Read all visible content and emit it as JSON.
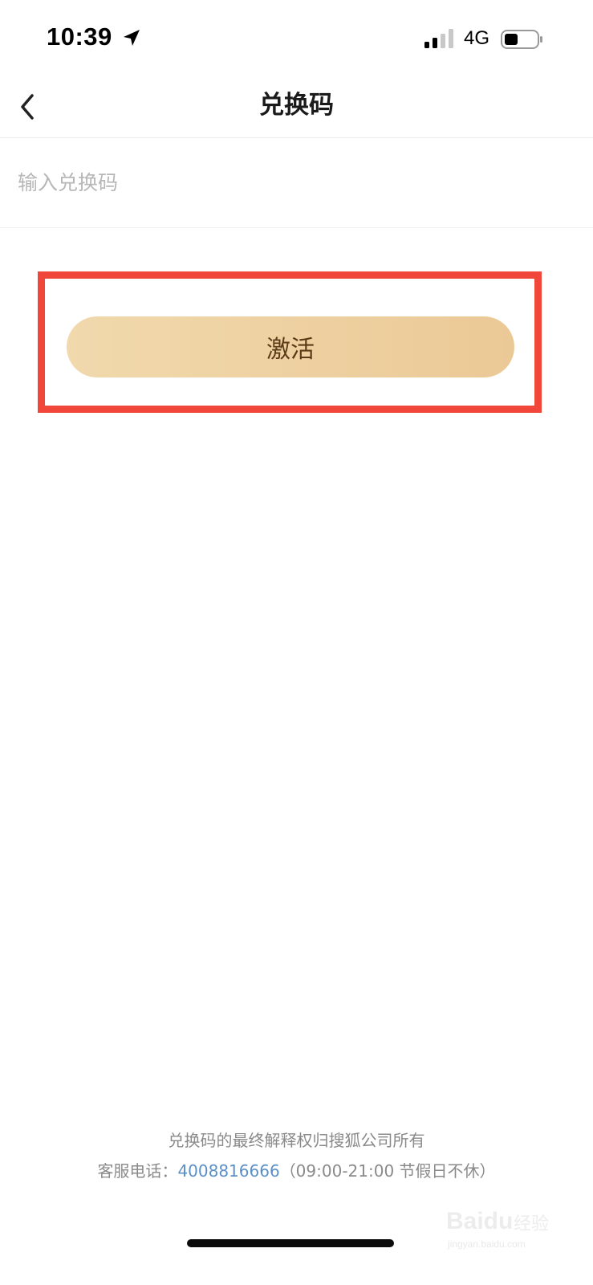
{
  "status_bar": {
    "time": "10:39",
    "network": "4G",
    "icons": [
      "location-arrow-icon",
      "signal-icon",
      "battery-icon"
    ]
  },
  "nav": {
    "title": "兑换码",
    "back_icon": "chevron-left-icon"
  },
  "code_input": {
    "placeholder": "输入兑换码",
    "value": ""
  },
  "activate_button": {
    "label": "激活"
  },
  "footer": {
    "notice": "兑换码的最终解释权归搜狐公司所有",
    "service_label": "客服电话：",
    "service_phone": "4008816666",
    "service_hours": "（09:00-21:00 节假日不休）"
  },
  "watermark": {
    "text_main": "Baidu",
    "text_cn": "经验",
    "text_sub": "jingyan.baidu.com"
  },
  "colors": {
    "highlight_border": "#f0473a",
    "button_gradient_start": "#f1d9ad",
    "button_gradient_end": "#ebc996",
    "button_text": "#5a3a17",
    "link": "#5b8fc8"
  }
}
